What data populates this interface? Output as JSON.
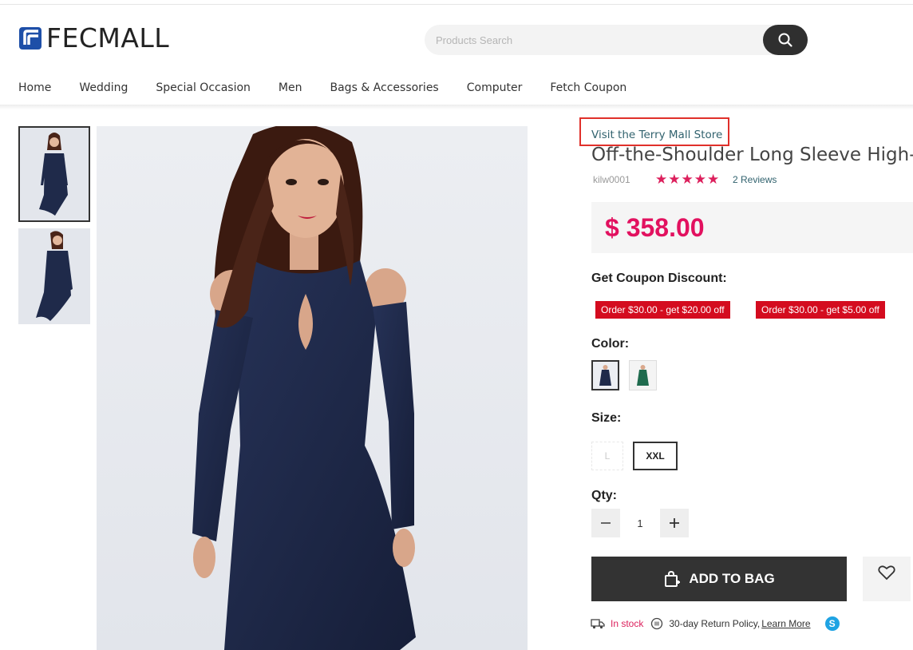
{
  "header": {
    "logo_text": "FECMALL",
    "search": {
      "placeholder": "Products Search"
    }
  },
  "nav": {
    "items": [
      "Home",
      "Wedding",
      "Special Occasion",
      "Men",
      "Bags & Accessories",
      "Computer",
      "Fetch Coupon"
    ]
  },
  "product": {
    "store_link": "Visit the Terry Mall Store",
    "title": "Off-the-Shoulder Long Sleeve High-L",
    "sku": "kilw0001",
    "stars": "★★★★★",
    "reviews": "2 Reviews",
    "price": "$ 358.00",
    "coupon_label": "Get Coupon Discount:",
    "coupons": [
      "Order $30.00 - get $20.00 off",
      "Order $30.00 - get $5.00 off"
    ],
    "color_label": "Color:",
    "colors": [
      "navy",
      "green"
    ],
    "size_label": "Size:",
    "sizes": [
      "L",
      "XXL"
    ],
    "qty_label": "Qty:",
    "qty_value": "1",
    "add_to_bag": "ADD TO BAG",
    "stock": "In stock",
    "return_policy": "30-day Return Policy,",
    "learn_more": "Learn More",
    "skype_letter": "S"
  },
  "colors": {
    "price": "#e2115f",
    "coupon": "#d40c1f",
    "link": "#31626e",
    "button": "#333333"
  },
  "icons": [
    "search-icon",
    "bag-icon",
    "heart-icon",
    "truck-icon",
    "return-icon",
    "skype-icon"
  ]
}
